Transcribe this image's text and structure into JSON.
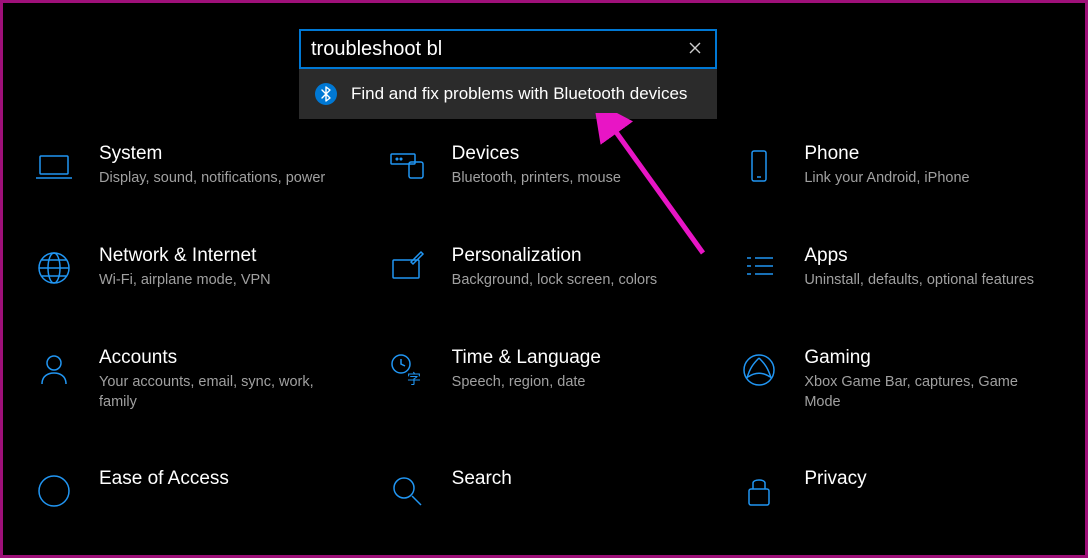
{
  "search": {
    "value": "troubleshoot bl",
    "clear_tooltip": "Clear"
  },
  "suggestion": {
    "icon": "bluetooth-icon",
    "text": "Find and fix problems with Bluetooth devices"
  },
  "tiles": [
    {
      "title": "System",
      "sub": "Display, sound, notifications, power"
    },
    {
      "title": "Devices",
      "sub": "Bluetooth, printers, mouse"
    },
    {
      "title": "Phone",
      "sub": "Link your Android, iPhone"
    },
    {
      "title": "Network & Internet",
      "sub": "Wi-Fi, airplane mode, VPN"
    },
    {
      "title": "Personalization",
      "sub": "Background, lock screen, colors"
    },
    {
      "title": "Apps",
      "sub": "Uninstall, defaults, optional features"
    },
    {
      "title": "Accounts",
      "sub": "Your accounts, email, sync, work, family"
    },
    {
      "title": "Time & Language",
      "sub": "Speech, region, date"
    },
    {
      "title": "Gaming",
      "sub": "Xbox Game Bar, captures, Game Mode"
    },
    {
      "title": "Ease of Access",
      "sub": ""
    },
    {
      "title": "Search",
      "sub": ""
    },
    {
      "title": "Privacy",
      "sub": ""
    }
  ],
  "colors": {
    "accent": "#0078d4",
    "arrow": "#e815c5"
  }
}
